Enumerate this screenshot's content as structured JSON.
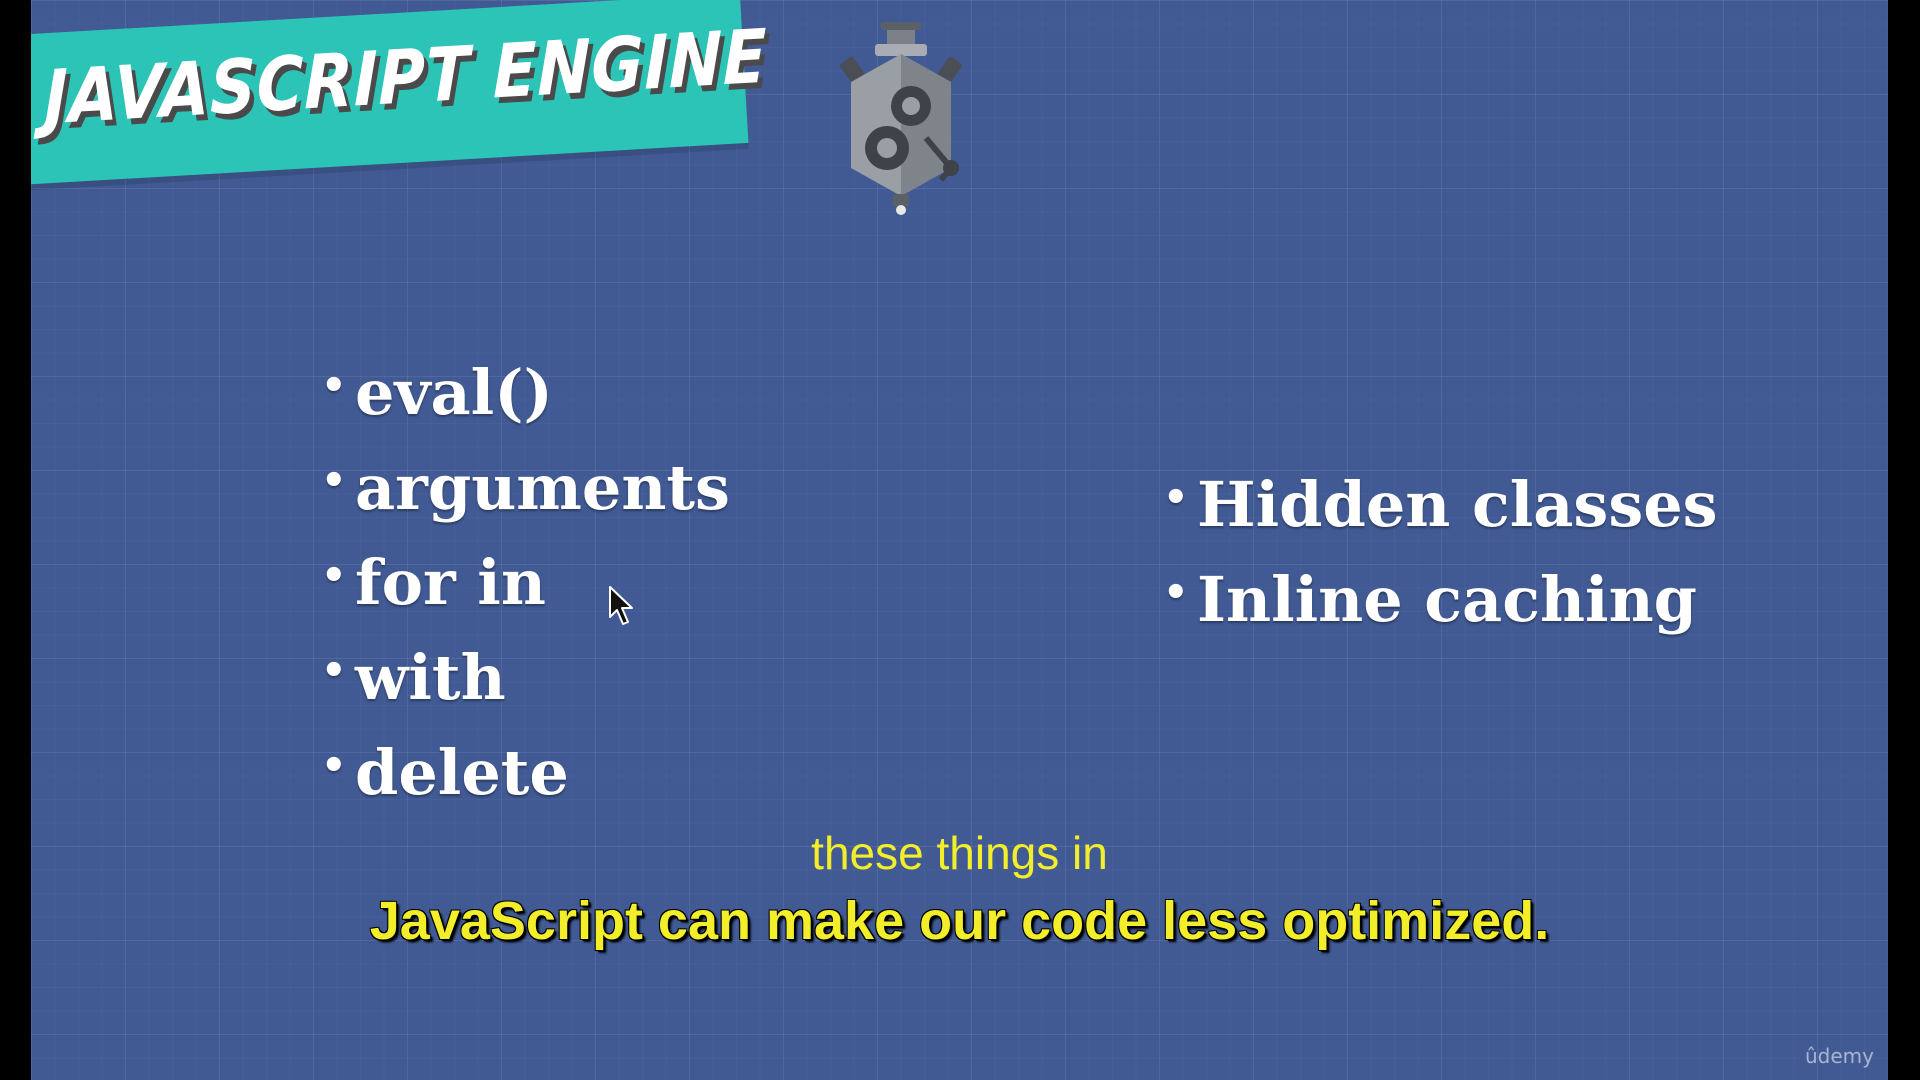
{
  "slide": {
    "title": "JAVASCRIPT ENGINE",
    "engine_icon": "engine-icon",
    "accent_color": "#2bc4b6",
    "background_color": "#415a94"
  },
  "left_list": [
    {
      "bullet": "•",
      "label": "eval()"
    },
    {
      "bullet": "•",
      "label": "arguments"
    },
    {
      "bullet": "•",
      "label": "for in"
    },
    {
      "bullet": "•",
      "label": "with"
    },
    {
      "bullet": "•",
      "label": "delete"
    }
  ],
  "right_list": [
    {
      "bullet": "•",
      "label": "Hidden classes"
    },
    {
      "bullet": "•",
      "label": "Inline caching"
    }
  ],
  "captions": {
    "line1": "these things in",
    "line2": "JavaScript can make our code less optimized.",
    "color": "#f2ee2a"
  },
  "watermark": "ûdemy",
  "cursor_icon": "arrow-cursor-icon"
}
